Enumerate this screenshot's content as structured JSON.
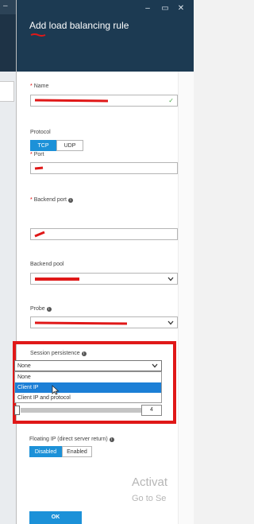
{
  "window": {
    "minimize_icon": "minimize-icon",
    "maximize_icon": "maximize-icon",
    "close_icon": "close-icon"
  },
  "blade": {
    "title": "Add load balancing rule"
  },
  "form": {
    "name": {
      "label": "Name",
      "required": "*",
      "valid_icon": "✓"
    },
    "protocol": {
      "label": "Protocol",
      "options": [
        "TCP",
        "UDP"
      ],
      "selected": "TCP"
    },
    "port": {
      "label": "Port",
      "required": "*"
    },
    "backend_port": {
      "label": "Backend port",
      "required": "*"
    },
    "backend_pool": {
      "label": "Backend pool"
    },
    "probe": {
      "label": "Probe"
    },
    "session_persistence": {
      "label": "Session persistence",
      "selected": "None",
      "options": [
        "None",
        "Client IP",
        "Client IP and protocol"
      ],
      "highlighted": "Client IP"
    },
    "idle_timeout": {
      "value": "4"
    },
    "floating_ip": {
      "label": "Floating IP (direct server return)",
      "options": [
        "Disabled",
        "Enabled"
      ],
      "selected": "Disabled"
    }
  },
  "watermark": {
    "line1": "Activat",
    "line2": "Go to Se"
  },
  "ok_button": "OK",
  "colors": {
    "header": "#1c3a52",
    "accent": "#1c91d8",
    "annotation_red": "#e01818"
  }
}
